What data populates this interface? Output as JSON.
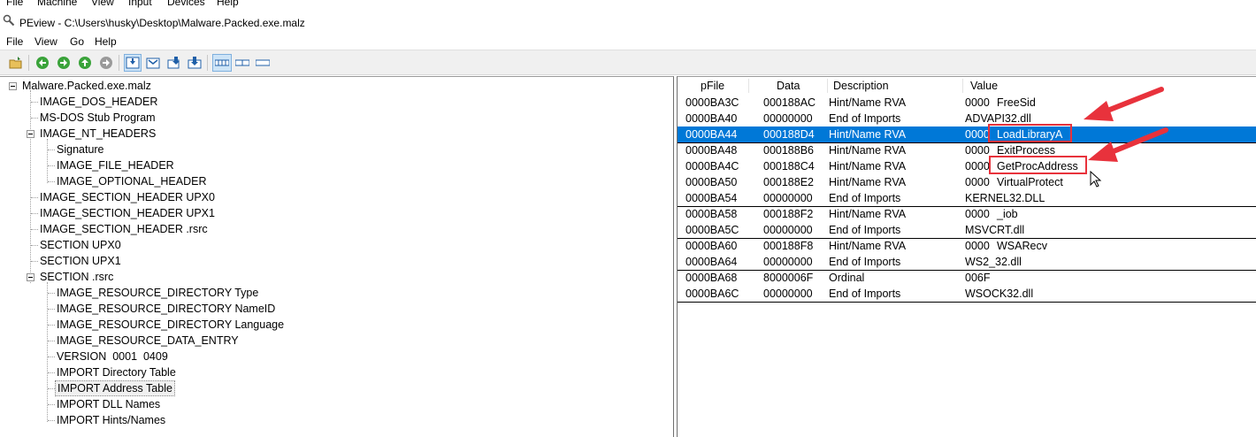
{
  "vm_menu": {
    "items": [
      "File",
      "Machine",
      "View",
      "Input",
      "Devices",
      "Help"
    ]
  },
  "window": {
    "title": "PEview - C:\\Users\\husky\\Desktop\\Malware.Packed.exe.malz"
  },
  "menu": {
    "items": [
      "File",
      "View",
      "Go",
      "Help"
    ]
  },
  "toolbar": {
    "icons": [
      "open-icon",
      "back-icon",
      "forward-icon",
      "up-icon",
      "previous-icon",
      "next-icon",
      "save-icon",
      "export-icon",
      "import-icon",
      "view-byte-icon",
      "view-word-icon",
      "view-dword-icon"
    ]
  },
  "tree": {
    "root": "Malware.Packed.exe.malz",
    "items": [
      "IMAGE_DOS_HEADER",
      "MS-DOS Stub Program",
      "IMAGE_NT_HEADERS",
      "Signature",
      "IMAGE_FILE_HEADER",
      "IMAGE_OPTIONAL_HEADER",
      "IMAGE_SECTION_HEADER UPX0",
      "IMAGE_SECTION_HEADER UPX1",
      "IMAGE_SECTION_HEADER .rsrc",
      "SECTION UPX0",
      "SECTION UPX1",
      "SECTION .rsrc",
      "IMAGE_RESOURCE_DIRECTORY Type",
      "IMAGE_RESOURCE_DIRECTORY NameID",
      "IMAGE_RESOURCE_DIRECTORY Language",
      "IMAGE_RESOURCE_DATA_ENTRY",
      "VERSION  0001  0409",
      "IMPORT Directory Table",
      "IMPORT Address Table",
      "IMPORT DLL Names",
      "IMPORT Hints/Names"
    ]
  },
  "table": {
    "columns": [
      "pFile",
      "Data",
      "Description",
      "Value"
    ],
    "rows": [
      {
        "pfile": "0000BA3C",
        "data": "000188AC",
        "desc": "Hint/Name RVA",
        "hint": "0000",
        "name": "FreeSid"
      },
      {
        "pfile": "0000BA40",
        "data": "00000000",
        "desc": "End of Imports",
        "hint": "",
        "name": "ADVAPI32.dll"
      },
      {
        "pfile": "0000BA44",
        "data": "000188D4",
        "desc": "Hint/Name RVA",
        "hint": "0000",
        "name": "LoadLibraryA"
      },
      {
        "pfile": "0000BA48",
        "data": "000188B6",
        "desc": "Hint/Name RVA",
        "hint": "0000",
        "name": "ExitProcess"
      },
      {
        "pfile": "0000BA4C",
        "data": "000188C4",
        "desc": "Hint/Name RVA",
        "hint": "0000",
        "name": "GetProcAddress"
      },
      {
        "pfile": "0000BA50",
        "data": "000188E2",
        "desc": "Hint/Name RVA",
        "hint": "0000",
        "name": "VirtualProtect"
      },
      {
        "pfile": "0000BA54",
        "data": "00000000",
        "desc": "End of Imports",
        "hint": "",
        "name": "KERNEL32.DLL"
      },
      {
        "pfile": "0000BA58",
        "data": "000188F2",
        "desc": "Hint/Name RVA",
        "hint": "0000",
        "name": "_iob"
      },
      {
        "pfile": "0000BA5C",
        "data": "00000000",
        "desc": "End of Imports",
        "hint": "",
        "name": "MSVCRT.dll"
      },
      {
        "pfile": "0000BA60",
        "data": "000188F8",
        "desc": "Hint/Name RVA",
        "hint": "0000",
        "name": "WSARecv"
      },
      {
        "pfile": "0000BA64",
        "data": "00000000",
        "desc": "End of Imports",
        "hint": "",
        "name": "WS2_32.dll"
      },
      {
        "pfile": "0000BA68",
        "data": "8000006F",
        "desc": "Ordinal",
        "hint": "",
        "name": "006F"
      },
      {
        "pfile": "0000BA6C",
        "data": "00000000",
        "desc": "End of Imports",
        "hint": "",
        "name": "WSOCK32.dll"
      }
    ]
  },
  "colors": {
    "selection": "#0078d7",
    "annotation": "#e8323c"
  }
}
